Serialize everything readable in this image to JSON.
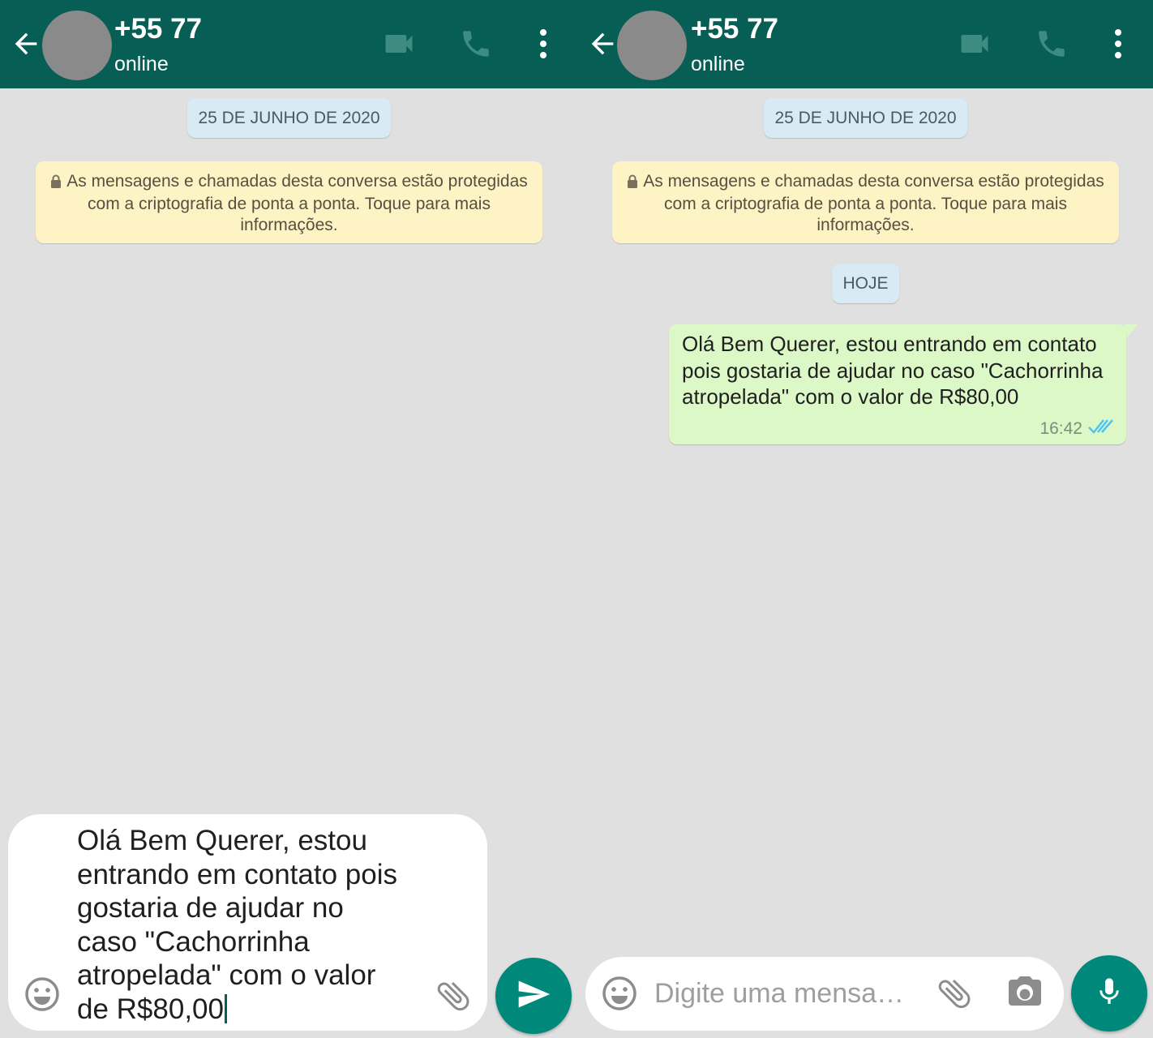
{
  "colors": {
    "app_bar": "#075e54",
    "background": "#e0e0e0",
    "outgoing_bubble": "#dcf8c6",
    "encryption_notice": "#fdf3c4",
    "date_pill": "#d8ebf5",
    "fab": "#00897b",
    "read_ticks": "#4fc3f7"
  },
  "left": {
    "header": {
      "title": "+55 77",
      "status": "online"
    },
    "date_pill": "25 DE JUNHO DE 2020",
    "encryption_notice": "As mensagens e chamadas desta conversa estão protegidas com a criptografia de ponta a ponta. Toque para mais informações.",
    "composer": {
      "text": "Olá Bem Querer, estou entrando em contato pois gostaria de ajudar no caso \"Cachorrinha atropelada\" com o valor de R$80,00"
    },
    "icons": [
      "back-arrow-icon",
      "video-call-icon",
      "phone-icon",
      "more-vert-icon",
      "emoji-icon",
      "attach-icon",
      "send-icon"
    ]
  },
  "right": {
    "header": {
      "title": "+55 77",
      "status": "online"
    },
    "date_pill": "25 DE JUNHO DE 2020",
    "encryption_notice": "As mensagens e chamadas desta conversa estão protegidas com a criptografia de ponta a ponta. Toque para mais informações.",
    "today_pill": "HOJE",
    "message": {
      "text": "Olá Bem Querer, estou entrando em contato pois gostaria de ajudar no caso \"Cachorrinha atropelada\" com o valor de R$80,00",
      "time": "16:42",
      "status": "read"
    },
    "composer": {
      "placeholder": "Digite uma mensa…"
    },
    "icons": [
      "back-arrow-icon",
      "video-call-icon",
      "phone-icon",
      "more-vert-icon",
      "emoji-icon",
      "attach-icon",
      "camera-icon",
      "mic-icon"
    ]
  }
}
